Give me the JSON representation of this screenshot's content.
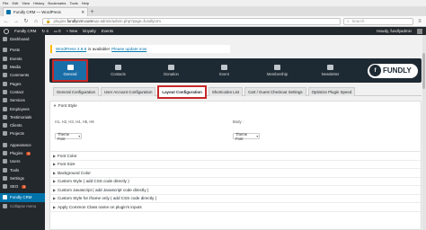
{
  "browser": {
    "menu": [
      "File",
      "Edit",
      "View",
      "History",
      "Bookmarks",
      "Tools",
      "Help"
    ],
    "tab_title": "Fundly CRM — WordPress",
    "url_prefix": "plugins.",
    "url_domain": "fundlycrm.com",
    "url_path": "/wp-admin/admin.php?page=fundlycrm",
    "search_placeholder": "Search"
  },
  "adminbar": {
    "site": "Fundly CRM",
    "updates": "4",
    "comments": "0",
    "new": "New",
    "user1": "kinyalty",
    "events": "Events",
    "greeting": "Howdy, fundlyadmin"
  },
  "sidebar": {
    "items": [
      {
        "label": "Dashboard"
      },
      {
        "label": "Posts"
      },
      {
        "label": "Events"
      },
      {
        "label": "Media"
      },
      {
        "label": "Comments"
      },
      {
        "label": "Pages"
      },
      {
        "label": "Contact"
      },
      {
        "label": "Services"
      },
      {
        "label": "Employees"
      },
      {
        "label": "Testimonials"
      },
      {
        "label": "Clients"
      },
      {
        "label": "Projects"
      },
      {
        "label": "Appearance"
      },
      {
        "label": "Plugins",
        "badge": "4"
      },
      {
        "label": "Users"
      },
      {
        "label": "Tools"
      },
      {
        "label": "Settings"
      },
      {
        "label": "SEO",
        "badge": "3"
      },
      {
        "label": "Fundly CRM"
      },
      {
        "label": "Collapse menu"
      }
    ]
  },
  "notice": {
    "text": "WordPress 4.9.8",
    "middle": "is available!",
    "link": "Please update now"
  },
  "fundly_tabs": [
    "General",
    "Contacts",
    "Donation",
    "Event",
    "Membership",
    "Newsletter"
  ],
  "logo_text": "FUNDLY",
  "subtabs": [
    "General Configuration",
    "User Account Configuration",
    "Layout Configuration",
    "Shortcodes List",
    "Cart / Guest Checkout Settings",
    "Optimize Plugin Speed"
  ],
  "panel": {
    "font_style_label": "Font Style",
    "headings_line": "H1, H2, H3, H4, H5, H6",
    "body_label": "Body :",
    "select_value": "Theme Font",
    "rows": [
      "Font Color",
      "Font Size",
      "Background Color",
      "Custom Style ( add CSS code directly )",
      "Custom Javascript ( add Javascript code directly )",
      "Custom Style for iframe only ( add CSS code directly )",
      "Apply Common Class name on plugin's inputs"
    ]
  },
  "colors": {
    "accent": "#0073aa",
    "highlight": "#c62828",
    "dark": "#23282d",
    "fundly_bar": "#1e2a33"
  }
}
